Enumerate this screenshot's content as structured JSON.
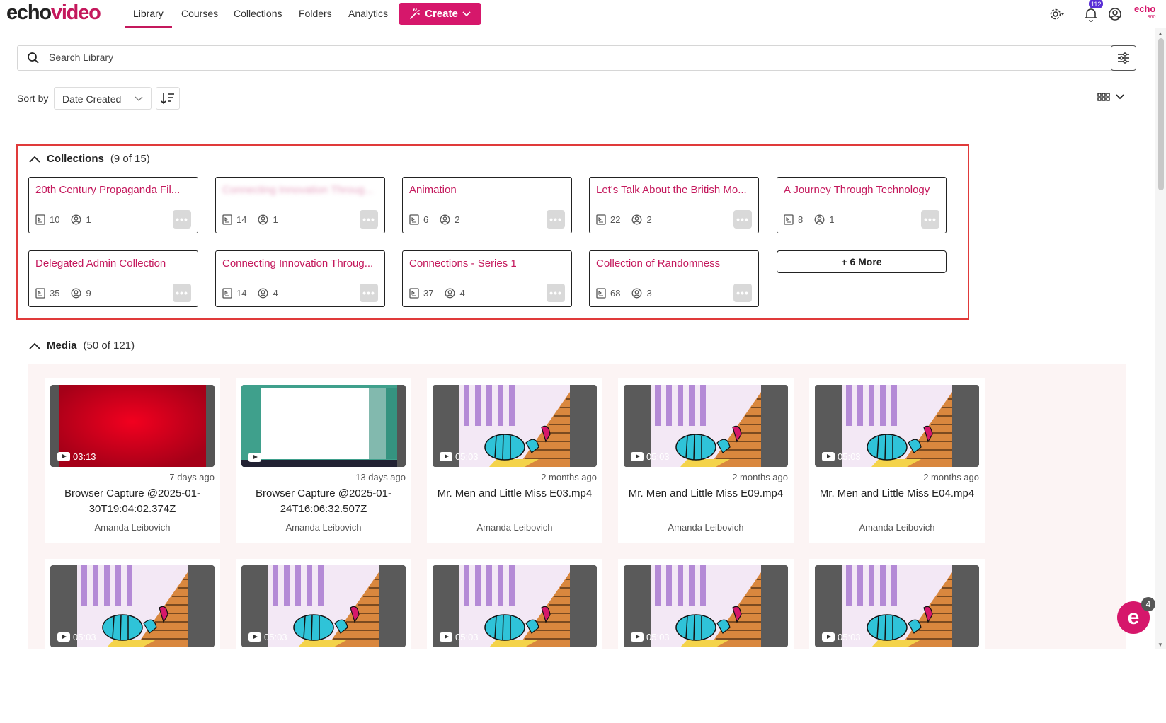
{
  "app": {
    "logo_part1": "echo",
    "logo_part2": "video",
    "brand_color": "#c4185c",
    "corner_logo": "echo",
    "corner_logo_sub": "360"
  },
  "nav": {
    "items": [
      {
        "label": "Library",
        "active": true
      },
      {
        "label": "Courses"
      },
      {
        "label": "Collections"
      },
      {
        "label": "Folders"
      },
      {
        "label": "Analytics"
      }
    ],
    "create_label": "Create",
    "notification_count": "112"
  },
  "search": {
    "placeholder": "Search Library"
  },
  "sort": {
    "label": "Sort by",
    "selected": "Date Created"
  },
  "collections": {
    "title": "Collections",
    "count": "(9 of 15)",
    "more_label": "+ 6 More",
    "items": [
      {
        "title": "20th Century Propaganda Fil...",
        "media": "10",
        "members": "1"
      },
      {
        "title": "Connecting Innovation Throug...",
        "media": "14",
        "members": "1",
        "blurred": true
      },
      {
        "title": "Animation",
        "media": "6",
        "members": "2"
      },
      {
        "title": "Let's Talk About the British Mo...",
        "media": "22",
        "members": "2"
      },
      {
        "title": "A Journey Through Technology",
        "media": "8",
        "members": "1"
      },
      {
        "title": "Delegated Admin Collection",
        "media": "35",
        "members": "9"
      },
      {
        "title": "Connecting Innovation Throug...",
        "media": "14",
        "members": "4"
      },
      {
        "title": "Connections - Series 1",
        "media": "37",
        "members": "4"
      },
      {
        "title": "Collection of Randomness",
        "media": "68",
        "members": "3"
      }
    ]
  },
  "media": {
    "title": "Media",
    "count": "(50 of 121)",
    "items": [
      {
        "thumb": "red",
        "duration": "03:13",
        "date": "7 days ago",
        "title": "Browser Capture @2025-01-30T19:04:02.374Z",
        "owner": "Amanda Leibovich"
      },
      {
        "thumb": "screen",
        "duration": "",
        "date": "13 days ago",
        "title": "Browser Capture @2025-01-24T16:06:32.507Z",
        "owner": "Amanda Leibovich"
      },
      {
        "thumb": "cartoon",
        "duration": "05:03",
        "date": "2 months ago",
        "title": "Mr. Men and Little Miss E03.mp4",
        "owner": "Amanda Leibovich"
      },
      {
        "thumb": "cartoon",
        "duration": "05:03",
        "date": "2 months ago",
        "title": "Mr. Men and Little Miss E09.mp4",
        "owner": "Amanda Leibovich"
      },
      {
        "thumb": "cartoon",
        "duration": "05:03",
        "date": "2 months ago",
        "title": "Mr. Men and Little Miss E04.mp4",
        "owner": "Amanda Leibovich"
      },
      {
        "thumb": "cartoon",
        "duration": "05:03",
        "date": "",
        "title": "",
        "owner": ""
      },
      {
        "thumb": "cartoon",
        "duration": "05:03",
        "date": "",
        "title": "",
        "owner": ""
      },
      {
        "thumb": "cartoon",
        "duration": "05:03",
        "date": "",
        "title": "",
        "owner": ""
      },
      {
        "thumb": "cartoon",
        "duration": "05:03",
        "date": "",
        "title": "",
        "owner": ""
      },
      {
        "thumb": "cartoon",
        "duration": "05:03",
        "date": "",
        "title": "",
        "owner": ""
      }
    ]
  },
  "chat": {
    "badge": "4",
    "letter": "e"
  }
}
